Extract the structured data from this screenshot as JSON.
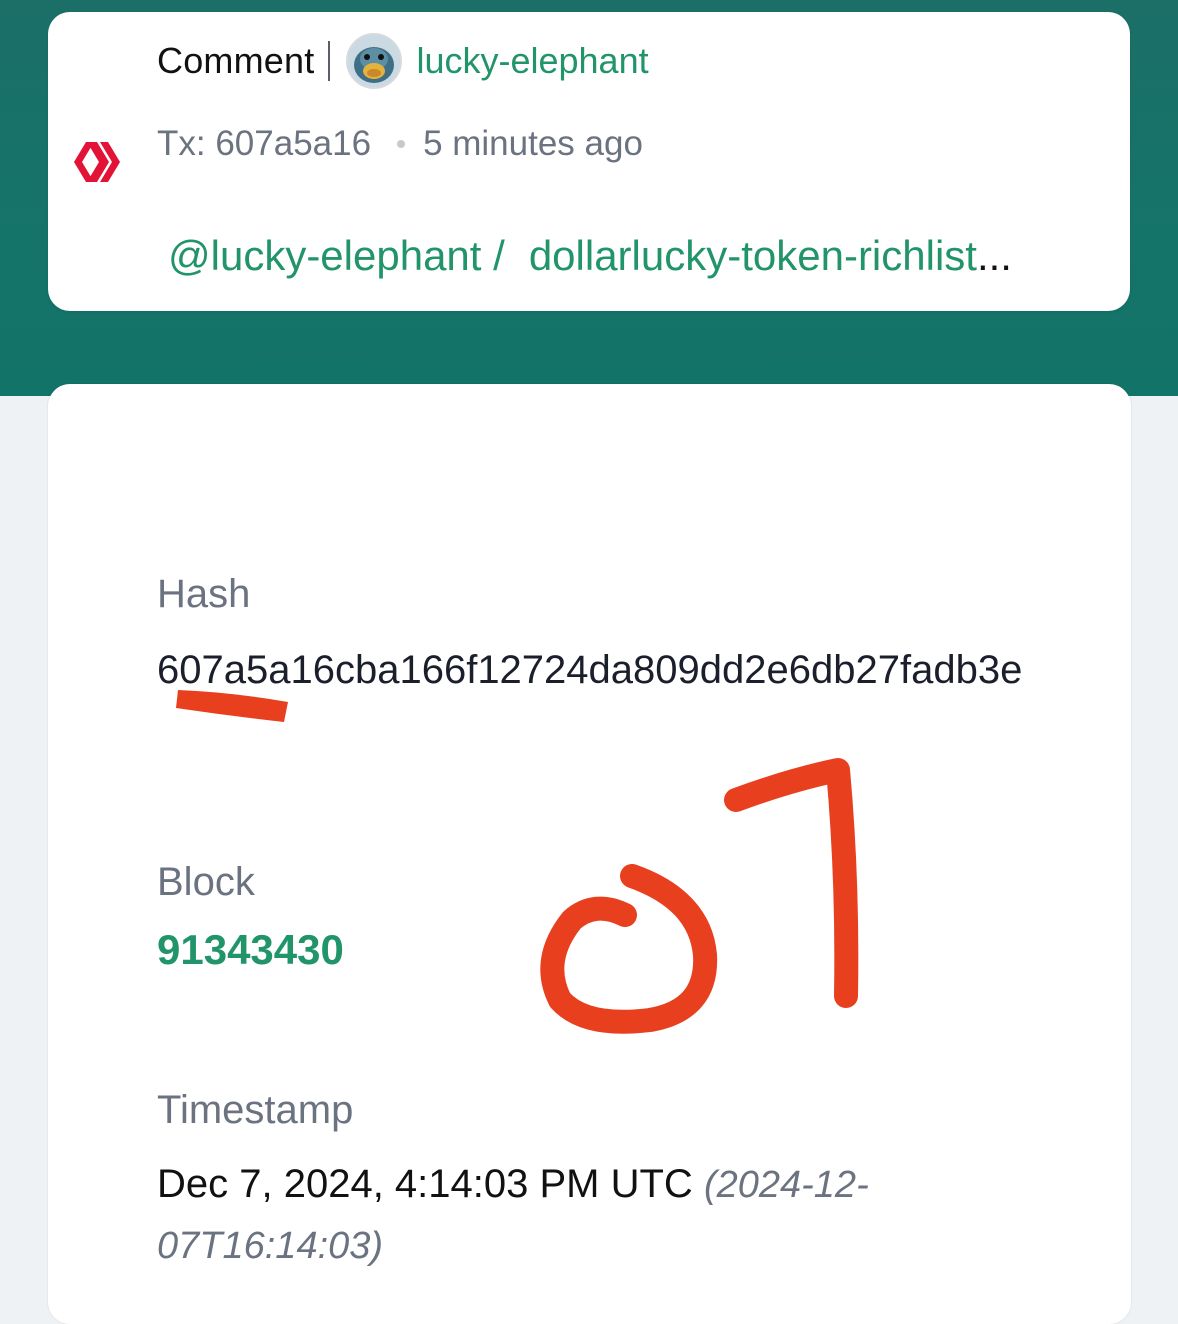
{
  "operation": {
    "type_label": "Comment",
    "username": "lucky-elephant",
    "tx_label": "Tx: 607a5a16",
    "time_ago": "5 minutes ago",
    "author_link": "@lucky-elephant /",
    "permlink": "dollarlucky-token-richlist",
    "truncation": "..."
  },
  "details": {
    "hash_label": "Hash",
    "hash_value": "607a5a16cba166f12724da809dd2e6db27fadb3e",
    "block_label": "Block",
    "block_value": "91343430",
    "timestamp_label": "Timestamp",
    "timestamp_value": "Dec 7, 2024, 4:14:03 PM UTC",
    "timestamp_iso": "(2024-12-07T16:14:03)"
  },
  "icons": {
    "chain_logo": "hive-logo-icon",
    "avatar": "user-avatar"
  },
  "colors": {
    "accent_green": "#22946a",
    "header_teal": "#15746a",
    "logo_red": "#e31337",
    "annotation_red": "#e8401f"
  }
}
